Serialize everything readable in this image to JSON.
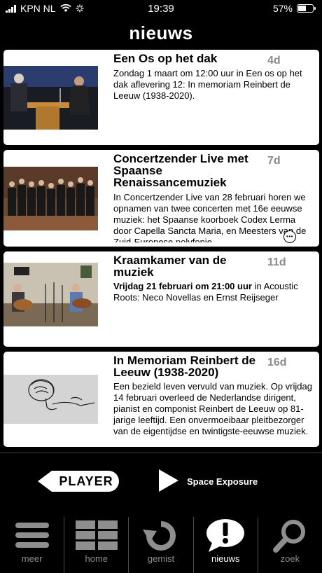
{
  "status": {
    "carrier": "KPN NL",
    "time": "19:39",
    "battery": "57%",
    "battery_level": 0.57
  },
  "page_title": "nieuws",
  "news": [
    {
      "title": "Een Os op het dak",
      "age": "4d",
      "body_bold": "",
      "body": "Zondag 1 maart om 12:00 uur in Een os op het dak aflevering 12: In memoriam Reinbert de Leeuw (1938-2020)."
    },
    {
      "title": "Concertzender Live met Spaanse Renaissancemuziek",
      "age": "7d",
      "body_bold": "",
      "body": "In Concertzender Live van 28 februari horen we opnamen van twee concerten met 16e eeuwse muziek: het Spaanse koorboek Codex Lerma door Capella Sancta Maria, en Meesters van de Zuid-Europese polyfonie"
    },
    {
      "title": "Kraamkamer van de muziek",
      "age": "11d",
      "body_bold": "Vrijdag 21 februari om 21:00 uur",
      "body": " in Acoustic Roots: Neco Novellas en Ernst Reijseger"
    },
    {
      "title": "In Memoriam Reinbert de Leeuw (1938-2020)",
      "age": "16d",
      "body_bold": "",
      "body": "Een bezield leven vervuld van muziek. Op vrijdag 14 februari overleed de Nederlandse dirigent, pianist en componist Reinbert de Leeuw op 81-jarige leeftijd. Een onvermoeibaar pleitbezorger van de eigentijdse en twintigste-eeuwse muziek."
    }
  ],
  "player": {
    "label": "PLAYER",
    "now_playing": "Space Exposure"
  },
  "nav": [
    {
      "label": "meer",
      "icon": "menu-icon",
      "active": false
    },
    {
      "label": "home",
      "icon": "grid-icon",
      "active": false
    },
    {
      "label": "gemist",
      "icon": "replay-icon",
      "active": false
    },
    {
      "label": "nieuws",
      "icon": "news-icon",
      "active": true
    },
    {
      "label": "zoek",
      "icon": "search-icon",
      "active": false
    }
  ]
}
